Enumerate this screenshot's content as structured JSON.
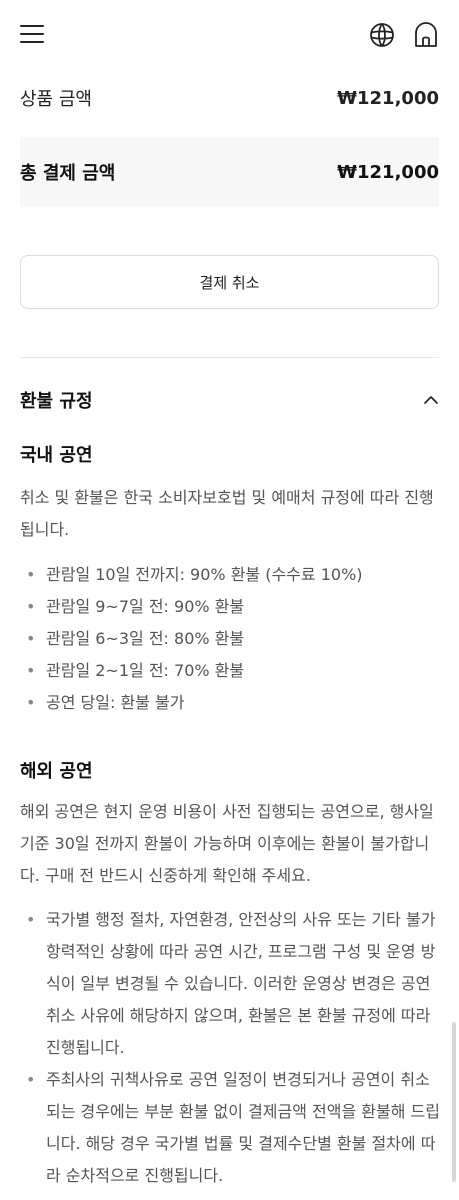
{
  "header": {
    "menu_icon": "hamburger-menu-icon",
    "globe_icon": "globe-icon",
    "home_icon": "home-icon"
  },
  "summary": {
    "subtotal_label": "상품 금액",
    "subtotal_value": "₩121,000",
    "total_label": "총 결제 금액",
    "total_value": "₩121,000"
  },
  "cancel_button_label": "결제 취소",
  "policy": {
    "title": "환불 규정",
    "domestic": {
      "title": "국내 공연",
      "description": "취소 및 환불은 한국 소비자보호법 및 예매처 규정에 따라 진행됩니다.",
      "items": [
        "관람일 10일 전까지: 90% 환불 (수수료 10%)",
        "관람일 9~7일 전: 90% 환불",
        "관람일 6~3일 전: 80% 환불",
        "관람일 2~1일 전: 70% 환불",
        "공연 당일: 환불 불가"
      ]
    },
    "overseas": {
      "title": "해외 공연",
      "description": "해외 공연은 현지 운영 비용이 사전 집행되는 공연으로, 행사일 기준 30일 전까지 환불이 가능하며 이후에는 환불이 불가합니다. 구매 전 반드시 신중하게 확인해 주세요.",
      "items": [
        "국가별 행정 절차, 자연환경, 안전상의 사유 또는 기타 불가항력적인 상황에 따라 공연 시간, 프로그램 구성 및 운영 방식이 일부 변경될 수 있습니다. 이러한 운영상 변경은 공연 취소 사유에 해당하지 않으며, 환불은 본 환불 규정에 따라 진행됩니다.",
        "주최사의 귀책사유로 공연 일정이 변경되거나 공연이 취소되는 경우에는 부분 환불 없이 결제금액 전액을 환불해 드립니다. 해당 경우 국가별 법률 및 결제수단별 환불 절차에 따라 순차적으로 진행됩니다."
      ]
    }
  }
}
